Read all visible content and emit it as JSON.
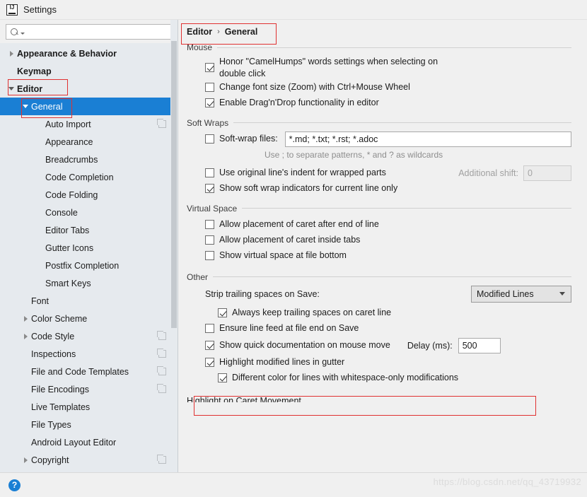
{
  "window": {
    "title": "Settings",
    "app_icon": "intellij-idea-icon"
  },
  "search": {
    "value": "",
    "placeholder": "",
    "icon": "search-icon"
  },
  "sidebar": {
    "items": [
      {
        "label": "Appearance & Behavior",
        "level": 0,
        "arrow": "right",
        "bold": true,
        "selected": false,
        "copy": false
      },
      {
        "label": "Keymap",
        "level": 0,
        "arrow": "none",
        "bold": true,
        "selected": false,
        "copy": false
      },
      {
        "label": "Editor",
        "level": 0,
        "arrow": "down",
        "bold": true,
        "selected": false,
        "copy": false
      },
      {
        "label": "General",
        "level": 1,
        "arrow": "down",
        "bold": false,
        "selected": true,
        "copy": false
      },
      {
        "label": "Auto Import",
        "level": 2,
        "arrow": "none",
        "bold": false,
        "selected": false,
        "copy": true
      },
      {
        "label": "Appearance",
        "level": 2,
        "arrow": "none",
        "bold": false,
        "selected": false,
        "copy": false
      },
      {
        "label": "Breadcrumbs",
        "level": 2,
        "arrow": "none",
        "bold": false,
        "selected": false,
        "copy": false
      },
      {
        "label": "Code Completion",
        "level": 2,
        "arrow": "none",
        "bold": false,
        "selected": false,
        "copy": false
      },
      {
        "label": "Code Folding",
        "level": 2,
        "arrow": "none",
        "bold": false,
        "selected": false,
        "copy": false
      },
      {
        "label": "Console",
        "level": 2,
        "arrow": "none",
        "bold": false,
        "selected": false,
        "copy": false
      },
      {
        "label": "Editor Tabs",
        "level": 2,
        "arrow": "none",
        "bold": false,
        "selected": false,
        "copy": false
      },
      {
        "label": "Gutter Icons",
        "level": 2,
        "arrow": "none",
        "bold": false,
        "selected": false,
        "copy": false
      },
      {
        "label": "Postfix Completion",
        "level": 2,
        "arrow": "none",
        "bold": false,
        "selected": false,
        "copy": false
      },
      {
        "label": "Smart Keys",
        "level": 2,
        "arrow": "none",
        "bold": false,
        "selected": false,
        "copy": false
      },
      {
        "label": "Font",
        "level": 1,
        "arrow": "none",
        "bold": false,
        "selected": false,
        "copy": false
      },
      {
        "label": "Color Scheme",
        "level": 1,
        "arrow": "right",
        "bold": false,
        "selected": false,
        "copy": false
      },
      {
        "label": "Code Style",
        "level": 1,
        "arrow": "right",
        "bold": false,
        "selected": false,
        "copy": true
      },
      {
        "label": "Inspections",
        "level": 1,
        "arrow": "none",
        "bold": false,
        "selected": false,
        "copy": true
      },
      {
        "label": "File and Code Templates",
        "level": 1,
        "arrow": "none",
        "bold": false,
        "selected": false,
        "copy": true
      },
      {
        "label": "File Encodings",
        "level": 1,
        "arrow": "none",
        "bold": false,
        "selected": false,
        "copy": true
      },
      {
        "label": "Live Templates",
        "level": 1,
        "arrow": "none",
        "bold": false,
        "selected": false,
        "copy": false
      },
      {
        "label": "File Types",
        "level": 1,
        "arrow": "none",
        "bold": false,
        "selected": false,
        "copy": false
      },
      {
        "label": "Android Layout Editor",
        "level": 1,
        "arrow": "none",
        "bold": false,
        "selected": false,
        "copy": false
      },
      {
        "label": "Copyright",
        "level": 1,
        "arrow": "right",
        "bold": false,
        "selected": false,
        "copy": true
      }
    ]
  },
  "breadcrumb": {
    "parent": "Editor",
    "separator": "›",
    "current": "General"
  },
  "main": {
    "groups": [
      {
        "title": "Mouse",
        "rows": [
          {
            "kind": "checkbox",
            "label": "Honor \"CamelHumps\" words settings when selecting on double click",
            "checked": true,
            "indent": 0,
            "wrap": true
          },
          {
            "kind": "checkbox",
            "label": "Change font size (Zoom) with Ctrl+Mouse Wheel",
            "checked": false,
            "indent": 0
          },
          {
            "kind": "checkbox",
            "label": "Enable Drag'n'Drop functionality in editor",
            "checked": true,
            "indent": 0
          }
        ]
      },
      {
        "title": "Soft Wraps",
        "rows": [
          {
            "kind": "checkbox-input",
            "label": "Soft-wrap files:",
            "checked": false,
            "value": "*.md; *.txt; *.rst; *.adoc"
          },
          {
            "kind": "hint",
            "label": "Use ; to separate patterns, * and ? as wildcards"
          },
          {
            "kind": "checkbox-right",
            "label": "Use original line's indent for wrapped parts",
            "checked": false,
            "right_label": "Additional shift:",
            "right_value": "0",
            "right_disabled": true
          },
          {
            "kind": "checkbox",
            "label": "Show soft wrap indicators for current line only",
            "checked": true,
            "indent": 0
          }
        ]
      },
      {
        "title": "Virtual Space",
        "rows": [
          {
            "kind": "checkbox",
            "label": "Allow placement of caret after end of line",
            "checked": false,
            "indent": 0
          },
          {
            "kind": "checkbox",
            "label": "Allow placement of caret inside tabs",
            "checked": false,
            "indent": 0
          },
          {
            "kind": "checkbox",
            "label": "Show virtual space at file bottom",
            "checked": false,
            "indent": 0
          }
        ]
      },
      {
        "title": "Other",
        "rows": [
          {
            "kind": "label-combo",
            "label": "Strip trailing spaces on Save:",
            "combo_value": "Modified Lines"
          },
          {
            "kind": "checkbox",
            "label": "Always keep trailing spaces on caret line",
            "checked": true,
            "indent": 1
          },
          {
            "kind": "checkbox",
            "label": "Ensure line feed at file end on Save",
            "checked": false,
            "indent": 0
          },
          {
            "kind": "checkbox-delay",
            "label": "Show quick documentation on mouse move",
            "checked": true,
            "delay_label": "Delay (ms):",
            "delay_value": "500"
          },
          {
            "kind": "checkbox",
            "label": "Highlight modified lines in gutter",
            "checked": true,
            "indent": 0
          },
          {
            "kind": "checkbox",
            "label": "Different color for lines with whitespace-only modifications",
            "checked": true,
            "indent": 1
          }
        ]
      }
    ],
    "cut_off_group_title": "Highlight on Caret Movement"
  },
  "footer": {
    "help_icon": "help-icon",
    "help_glyph": "?"
  },
  "watermark": "https://blog.csdn.net/qq_43719932",
  "colors": {
    "selection_blue": "#1a7fd4",
    "annotation_red": "#e03131",
    "sidebar_bg": "#e6eaee",
    "panel_bg": "#f0f0f0"
  }
}
